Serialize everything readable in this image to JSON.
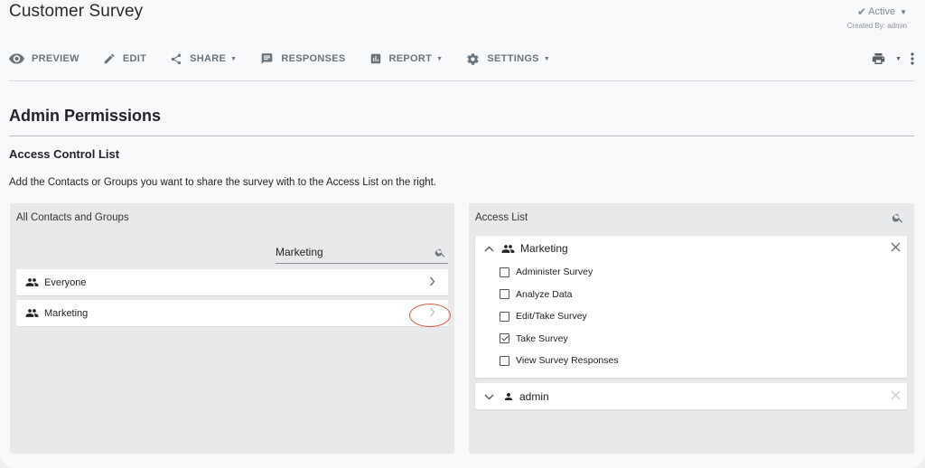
{
  "header": {
    "title": "Customer Survey",
    "status": "Active",
    "created_by": "Created By: admin"
  },
  "toolbar": {
    "preview": "PREVIEW",
    "edit": "EDIT",
    "share": "SHARE",
    "responses": "RESPONSES",
    "report": "REPORT",
    "settings": "SETTINGS"
  },
  "page": {
    "heading": "Admin Permissions",
    "subheading": "Access Control List",
    "description": "Add the Contacts or Groups you want to share the survey with to the Access List on the right."
  },
  "left_panel": {
    "title": "All Contacts and Groups",
    "search_value": "Marketing",
    "items": [
      {
        "label": "Everyone"
      },
      {
        "label": "Marketing"
      }
    ]
  },
  "right_panel": {
    "title": "Access List",
    "entries": [
      {
        "name": "Marketing",
        "expanded": true,
        "permissions": [
          {
            "label": "Administer Survey",
            "checked": false
          },
          {
            "label": "Analyze Data",
            "checked": false
          },
          {
            "label": "Edit/Take Survey",
            "checked": false
          },
          {
            "label": "Take Survey",
            "checked": true
          },
          {
            "label": "View Survey Responses",
            "checked": false
          }
        ]
      },
      {
        "name": "admin",
        "expanded": false
      }
    ]
  },
  "colors": {
    "annotation": "#d9553f",
    "toolbar_text": "#68737b"
  },
  "icons": [
    "eye-icon",
    "pencil-icon",
    "share-icon",
    "responses-icon",
    "report-icon",
    "gear-icon",
    "printer-icon",
    "more-vert-icon",
    "search-icon",
    "group-icon",
    "person-icon",
    "chevron-right-icon",
    "chevron-up-icon",
    "chevron-down-icon",
    "close-icon",
    "check-icon"
  ]
}
